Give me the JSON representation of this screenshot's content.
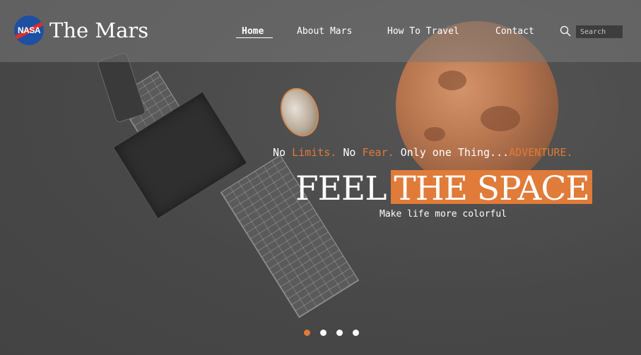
{
  "brand": {
    "logo_text": "NASA",
    "title": "The Mars"
  },
  "nav": {
    "items": [
      {
        "label": "Home",
        "active": true
      },
      {
        "label": "About Mars",
        "active": false
      },
      {
        "label": "How To Travel",
        "active": false
      },
      {
        "label": "Contact",
        "active": false
      }
    ]
  },
  "search": {
    "placeholder": "Search",
    "icon": "search-icon"
  },
  "hero": {
    "tagline": {
      "part1": "No ",
      "accent1": "Limits.",
      "part2": " No ",
      "accent2": "Fear.",
      "part3": " Only one Thing...",
      "accent3": "ADVENTURE."
    },
    "title_plain": "FEEL",
    "title_highlight": "THE SPACE",
    "subtitle": "Make life more colorful"
  },
  "carousel": {
    "slide_count": 4,
    "active_index": 0
  },
  "colors": {
    "accent": "#e07b39",
    "header_bg": "rgba(120,120,120,.55)",
    "logo_blue": "#1d4fa3",
    "logo_red": "#d6302b"
  }
}
